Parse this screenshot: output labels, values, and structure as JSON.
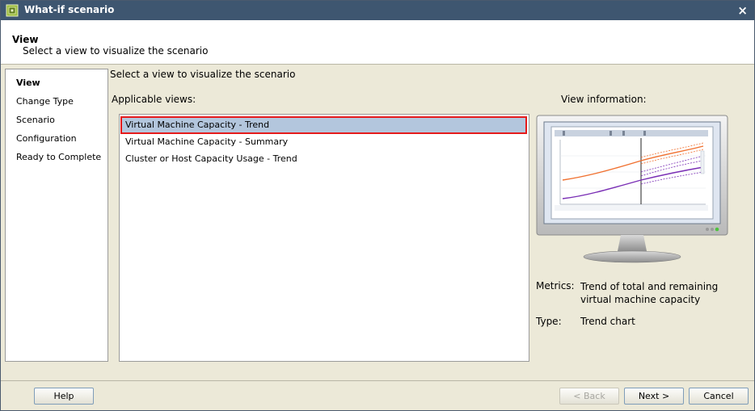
{
  "window": {
    "title": "What-if scenario",
    "close_glyph": "×",
    "icon": "what-if-app-icon"
  },
  "header": {
    "title": "View",
    "subtitle": "Select a view to visualize the scenario"
  },
  "nav": {
    "items": [
      {
        "label": "View",
        "active": true
      },
      {
        "label": "Change Type",
        "active": false
      },
      {
        "label": "Scenario",
        "active": false
      },
      {
        "label": "Configuration",
        "active": false
      },
      {
        "label": "Ready to Complete",
        "active": false
      }
    ]
  },
  "content": {
    "title": "Select a view to visualize the scenario",
    "applicable_label": "Applicable views:",
    "views": [
      {
        "label": "Virtual Machine Capacity - Trend",
        "selected": true
      },
      {
        "label": "Virtual Machine Capacity - Summary",
        "selected": false
      },
      {
        "label": "Cluster or Host Capacity Usage - Trend",
        "selected": false
      }
    ]
  },
  "info": {
    "label": "View information:",
    "metrics_key": "Metrics:",
    "metrics_value": "Trend of total and remaining virtual machine capacity",
    "type_key": "Type:",
    "type_value": "Trend chart"
  },
  "buttons": {
    "help": "Help",
    "back": "< Back",
    "next": "Next >",
    "cancel": "Cancel"
  },
  "colors": {
    "titlebar": "#3e5670",
    "selection": "#b3c6dd",
    "selection_outline": "#e51b1b"
  }
}
